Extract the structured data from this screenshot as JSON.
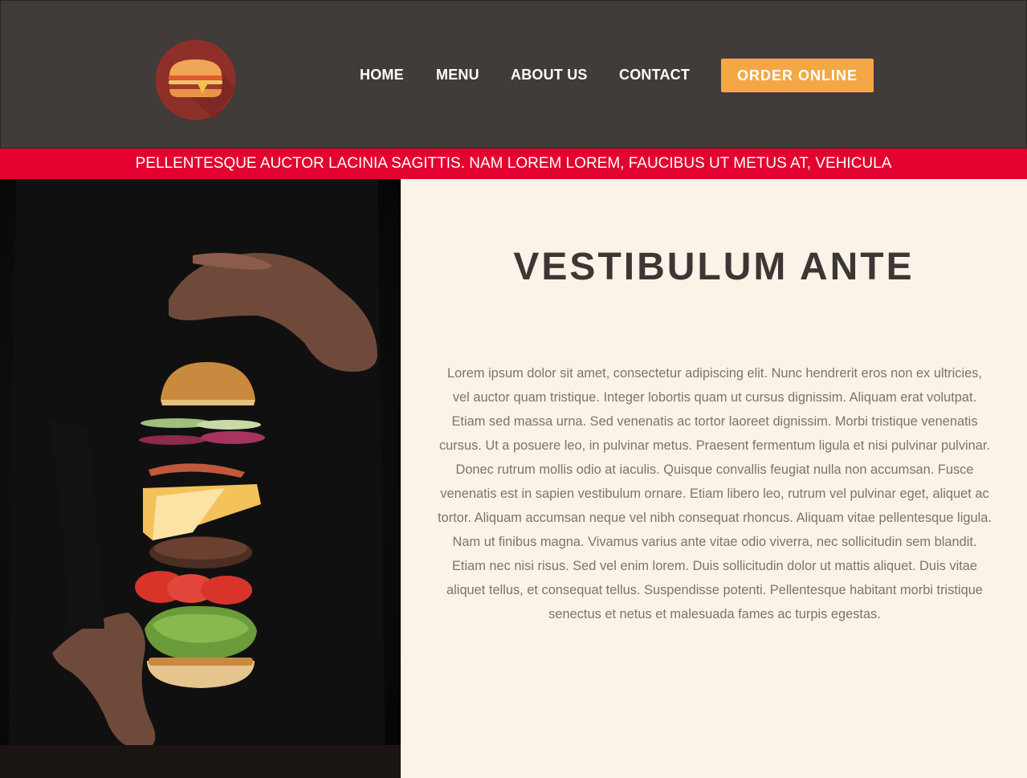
{
  "header": {
    "logo_name": "burger-logo-icon",
    "nav": [
      {
        "label": "HOME"
      },
      {
        "label": "MENU"
      },
      {
        "label": "ABOUT US"
      },
      {
        "label": "CONTACT"
      }
    ],
    "order_button": "ORDER ONLINE"
  },
  "ticker": {
    "text": "PELLENTESQUE AUCTOR LACINIA SAGITTIS. NAM LOREM LOREM, FAUCIBUS UT METUS AT, VEHICULA"
  },
  "hero": {
    "image": "floating-burger-photo",
    "title": "VESTIBULUM ANTE",
    "body": "Lorem ipsum dolor sit amet, consectetur adipiscing elit. Nunc hendrerit eros non ex ultricies, vel auctor quam tristique. Integer lobortis quam ut cursus dignissim. Aliquam erat volutpat. Etiam sed massa urna. Sed venenatis ac tortor laoreet dignissim. Morbi tristique venenatis cursus. Ut a posuere leo, in pulvinar metus. Praesent fermentum ligula et nisi pulvinar pulvinar. Donec rutrum mollis odio at iaculis. Quisque convallis feugiat nulla non accumsan. Fusce venenatis est in sapien vestibulum ornare. Etiam libero leo, rutrum vel pulvinar eget, aliquet ac tortor. Aliquam accumsan neque vel nibh consequat rhoncus. Aliquam vitae pellentesque ligula. Nam ut finibus magna. Vivamus varius ante vitae odio viverra, nec sollicitudin sem blandit. Etiam nec nisi risus. Sed vel enim lorem. Duis sollicitudin dolor ut mattis aliquet. Duis vitae aliquet tellus, et consequat tellus. Suspendisse potenti. Pellentesque habitant morbi tristique senectus et netus et malesuada fames ac turpis egestas."
  },
  "colors": {
    "header_bg": "#413b39",
    "accent_orange": "#f4a845",
    "ticker_red": "#e4002f",
    "content_bg": "#fbf3e7",
    "title_color": "#3c3634",
    "body_color": "#7b7471"
  }
}
